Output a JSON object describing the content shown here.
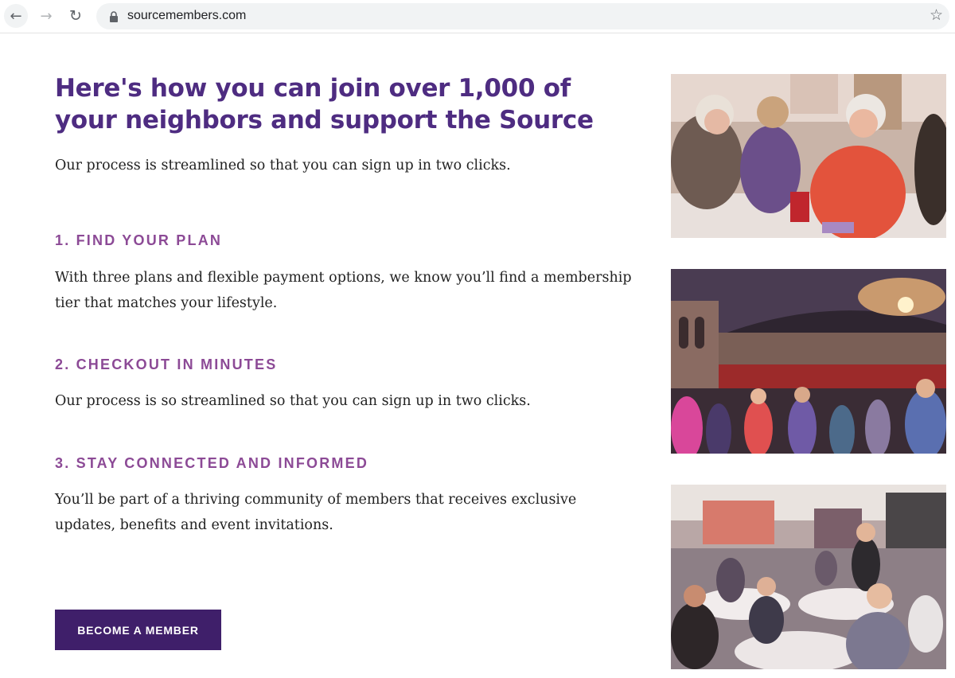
{
  "browser": {
    "url": "sourcemembers.com",
    "back_icon": "←",
    "forward_icon": "→",
    "reload_icon": "↻",
    "star_icon": "☆"
  },
  "page": {
    "headline": "Here's how you can join over 1,000 of your neighbors and support the Source",
    "intro": "Our process is streamlined so that you can sign up in two clicks.",
    "steps": [
      {
        "title": "1. FIND YOUR PLAN",
        "body": "With three plans and flexible payment options, we know you’ll find a membership tier that matches your lifestyle."
      },
      {
        "title": "2. CHECKOUT IN MINUTES",
        "body": "Our process is so streamlined so that you can sign up in two clicks."
      },
      {
        "title": "3. STAY CONNECTED AND INFORMED",
        "body": "You’ll be part of a thriving community of members that receives exclusive updates, benefits and event invitations."
      }
    ],
    "cta_label": "BECOME A MEMBER"
  },
  "colors": {
    "headline": "#4e2c81",
    "step_title": "#8c4a96",
    "cta_bg": "#3f1f6a"
  }
}
